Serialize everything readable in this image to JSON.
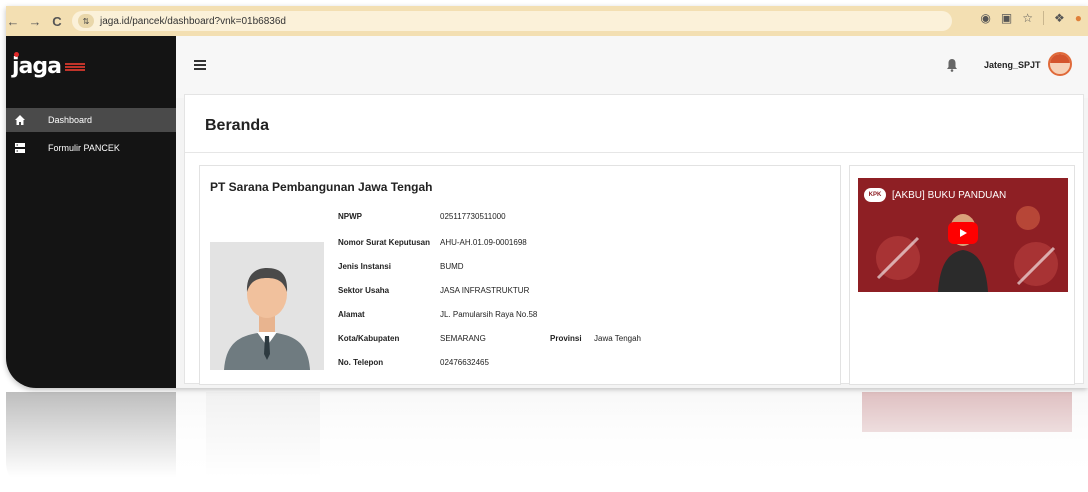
{
  "browser": {
    "url": "jaga.id/pancek/dashboard?vnk=01b6836d",
    "nav": {
      "back": "←",
      "forward": "→",
      "reload": "C"
    },
    "icons": [
      "eye-off-icon",
      "install-icon",
      "star-icon",
      "extensions-icon",
      "profile-icon"
    ]
  },
  "sidebar": {
    "logo": "jaga",
    "items": [
      {
        "label": "Dashboard",
        "icon": "home-icon",
        "active": true
      },
      {
        "label": "Formulir PANCEK",
        "icon": "server-icon",
        "active": false
      }
    ]
  },
  "topbar": {
    "username": "Jateng_SPJT"
  },
  "main": {
    "title": "Beranda",
    "company": {
      "name": "PT Sarana Pembangunan Jawa Tengah",
      "fields": {
        "npwp_label": "NPWP",
        "npwp_value": "025117730511000",
        "nomor_label": "Nomor Surat Keputusan",
        "nomor_value": "AHU-AH.01.09-0001698",
        "jenis_label": "Jenis Instansi",
        "jenis_value": "BUMD",
        "sektor_label": "Sektor Usaha",
        "sektor_value": "JASA INFRASTRUKTUR",
        "alamat_label": "Alamat",
        "alamat_value": "JL. Pamularsih Raya No.58",
        "kota_label": "Kota/Kabupaten",
        "kota_value": "SEMARANG",
        "provinsi_label": "Provinsi",
        "provinsi_value": "Jawa Tengah",
        "telepon_label": "No. Telepon",
        "telepon_value": "02476632465"
      }
    },
    "video": {
      "title": "[AKBU] BUKU PANDUAN",
      "badge": "KPK"
    }
  },
  "colors": {
    "sidebar_bg": "#141414",
    "active_item": "#4a4a4a",
    "browser_bar": "#f3dfb2",
    "video_bg": "#8e1f24",
    "play_red": "#ff0000"
  }
}
